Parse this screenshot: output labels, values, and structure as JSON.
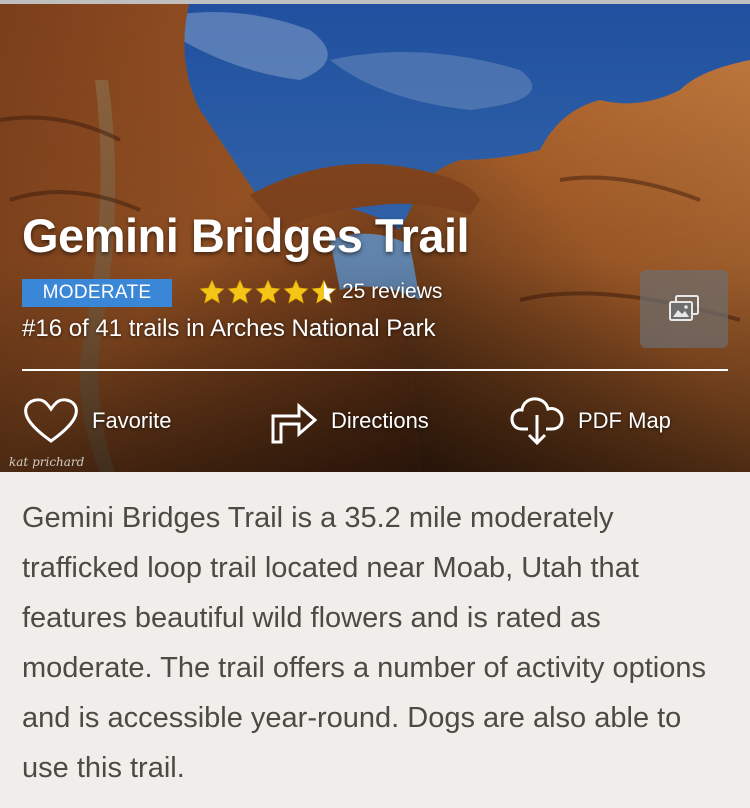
{
  "trail": {
    "name": "Gemini Bridges Trail",
    "difficulty": "MODERATE",
    "rating": 4.5,
    "reviews": "25 reviews",
    "rank_prefix": "#16 of 41 trails in ",
    "park": "Arches National Park",
    "photo_credit": "kat prichard"
  },
  "actions": {
    "favorite": "Favorite",
    "directions": "Directions",
    "pdf_map": "PDF Map"
  },
  "description": "Gemini Bridges Trail is a 35.2 mile moderately trafficked loop trail located near Moab, Utah that features beautiful wild flowers and is rated as moderate. The trail offers a number of activity options and is accessible year-round. Dogs are also able to use this trail.",
  "colors": {
    "badge": "#3b87d7",
    "star": "#f5c518",
    "description_text": "#4d4a43",
    "background": "#efeeea"
  },
  "icons": {
    "favorite": "heart-outline-icon",
    "directions": "turn-right-arrow-icon",
    "pdf_map": "cloud-download-icon",
    "photos": "photo-gallery-icon",
    "star": "star-icon"
  }
}
